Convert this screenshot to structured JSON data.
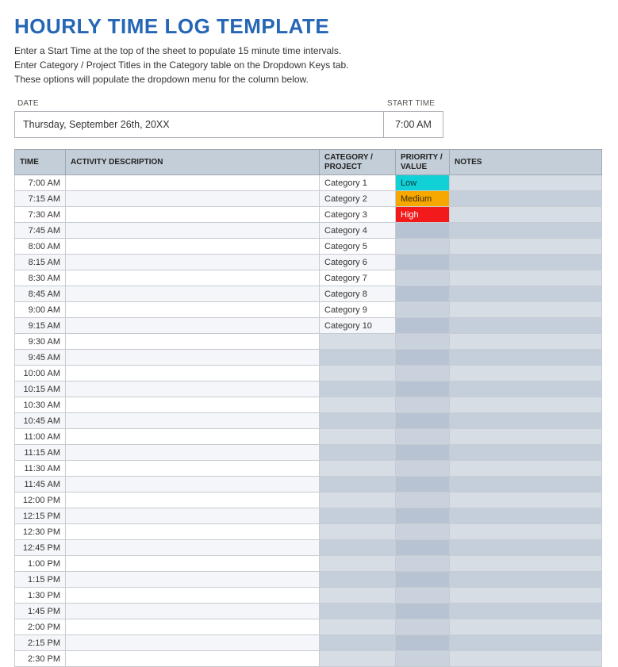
{
  "title": "HOURLY TIME LOG TEMPLATE",
  "instructions": [
    "Enter a Start Time at the top of the sheet to populate 15 minute time intervals.",
    "Enter Category / Project Titles in the Category table on the Dropdown Keys tab.",
    "These options will populate the dropdown menu for the column below."
  ],
  "meta": {
    "date_label": "DATE",
    "date_value": "Thursday, September 26th, 20XX",
    "start_label": "START TIME",
    "start_value": "7:00 AM"
  },
  "headers": {
    "time": "TIME",
    "activity": "ACTIVITY DESCRIPTION",
    "category": "CATEGORY / PROJECT",
    "priority": "PRIORITY / VALUE",
    "notes": "NOTES"
  },
  "rows": [
    {
      "time": "7:00 AM",
      "activity": "",
      "category": "Category 1",
      "priority": "Low",
      "priority_class": "prio-low",
      "notes": ""
    },
    {
      "time": "7:15 AM",
      "activity": "",
      "category": "Category 2",
      "priority": "Medium",
      "priority_class": "prio-med",
      "notes": ""
    },
    {
      "time": "7:30 AM",
      "activity": "",
      "category": "Category 3",
      "priority": "High",
      "priority_class": "prio-high",
      "notes": ""
    },
    {
      "time": "7:45 AM",
      "activity": "",
      "category": "Category 4",
      "priority": "",
      "priority_class": "",
      "notes": ""
    },
    {
      "time": "8:00 AM",
      "activity": "",
      "category": "Category 5",
      "priority": "",
      "priority_class": "",
      "notes": ""
    },
    {
      "time": "8:15 AM",
      "activity": "",
      "category": "Category 6",
      "priority": "",
      "priority_class": "",
      "notes": ""
    },
    {
      "time": "8:30 AM",
      "activity": "",
      "category": "Category 7",
      "priority": "",
      "priority_class": "",
      "notes": ""
    },
    {
      "time": "8:45 AM",
      "activity": "",
      "category": "Category 8",
      "priority": "",
      "priority_class": "",
      "notes": ""
    },
    {
      "time": "9:00 AM",
      "activity": "",
      "category": "Category 9",
      "priority": "",
      "priority_class": "",
      "notes": ""
    },
    {
      "time": "9:15 AM",
      "activity": "",
      "category": "Category 10",
      "priority": "",
      "priority_class": "",
      "notes": ""
    },
    {
      "time": "9:30 AM",
      "activity": "",
      "category": "",
      "priority": "",
      "priority_class": "",
      "notes": ""
    },
    {
      "time": "9:45 AM",
      "activity": "",
      "category": "",
      "priority": "",
      "priority_class": "",
      "notes": ""
    },
    {
      "time": "10:00 AM",
      "activity": "",
      "category": "",
      "priority": "",
      "priority_class": "",
      "notes": ""
    },
    {
      "time": "10:15 AM",
      "activity": "",
      "category": "",
      "priority": "",
      "priority_class": "",
      "notes": ""
    },
    {
      "time": "10:30 AM",
      "activity": "",
      "category": "",
      "priority": "",
      "priority_class": "",
      "notes": ""
    },
    {
      "time": "10:45 AM",
      "activity": "",
      "category": "",
      "priority": "",
      "priority_class": "",
      "notes": ""
    },
    {
      "time": "11:00 AM",
      "activity": "",
      "category": "",
      "priority": "",
      "priority_class": "",
      "notes": ""
    },
    {
      "time": "11:15 AM",
      "activity": "",
      "category": "",
      "priority": "",
      "priority_class": "",
      "notes": ""
    },
    {
      "time": "11:30 AM",
      "activity": "",
      "category": "",
      "priority": "",
      "priority_class": "",
      "notes": ""
    },
    {
      "time": "11:45 AM",
      "activity": "",
      "category": "",
      "priority": "",
      "priority_class": "",
      "notes": ""
    },
    {
      "time": "12:00 PM",
      "activity": "",
      "category": "",
      "priority": "",
      "priority_class": "",
      "notes": ""
    },
    {
      "time": "12:15 PM",
      "activity": "",
      "category": "",
      "priority": "",
      "priority_class": "",
      "notes": ""
    },
    {
      "time": "12:30 PM",
      "activity": "",
      "category": "",
      "priority": "",
      "priority_class": "",
      "notes": ""
    },
    {
      "time": "12:45 PM",
      "activity": "",
      "category": "",
      "priority": "",
      "priority_class": "",
      "notes": ""
    },
    {
      "time": "1:00 PM",
      "activity": "",
      "category": "",
      "priority": "",
      "priority_class": "",
      "notes": ""
    },
    {
      "time": "1:15 PM",
      "activity": "",
      "category": "",
      "priority": "",
      "priority_class": "",
      "notes": ""
    },
    {
      "time": "1:30 PM",
      "activity": "",
      "category": "",
      "priority": "",
      "priority_class": "",
      "notes": ""
    },
    {
      "time": "1:45 PM",
      "activity": "",
      "category": "",
      "priority": "",
      "priority_class": "",
      "notes": ""
    },
    {
      "time": "2:00 PM",
      "activity": "",
      "category": "",
      "priority": "",
      "priority_class": "",
      "notes": ""
    },
    {
      "time": "2:15 PM",
      "activity": "",
      "category": "",
      "priority": "",
      "priority_class": "",
      "notes": ""
    },
    {
      "time": "2:30 PM",
      "activity": "",
      "category": "",
      "priority": "",
      "priority_class": "",
      "notes": ""
    }
  ]
}
